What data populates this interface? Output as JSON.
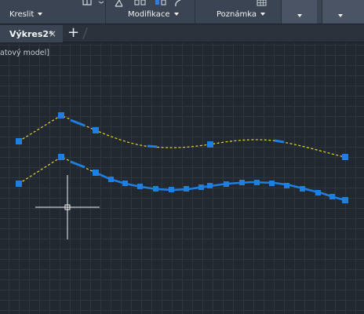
{
  "ribbon": {
    "groups": [
      {
        "id": "kreslit",
        "label": "Kreslit"
      },
      {
        "id": "modifikace",
        "label": "Modifikace"
      },
      {
        "id": "poznamka",
        "label": "Poznámka"
      }
    ]
  },
  "tabs": {
    "active": {
      "label": "Výkres2*",
      "close": "×"
    },
    "add": "+"
  },
  "viewport": {
    "label": "atový model]"
  },
  "colors": {
    "ribbon": "#3b4452",
    "canvas": "#212830",
    "grip": "#1e7fe0",
    "polyline": "#e8d433"
  }
}
